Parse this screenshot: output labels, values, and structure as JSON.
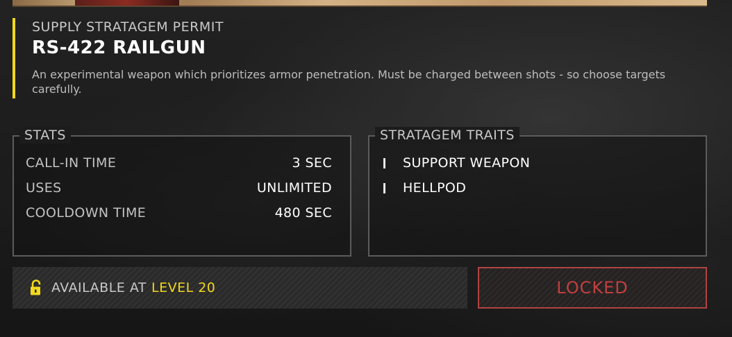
{
  "header": {
    "eyebrow": "SUPPLY STRATAGEM PERMIT",
    "title": "RS-422 RAILGUN",
    "description": "An experimental weapon which prioritizes armor penetration. Must be charged between shots - so choose targets carefully."
  },
  "stats": {
    "legend": "STATS",
    "rows": [
      {
        "label": "CALL-IN TIME",
        "value": "3 SEC"
      },
      {
        "label": "USES",
        "value": "UNLIMITED"
      },
      {
        "label": "COOLDOWN TIME",
        "value": "480 SEC"
      }
    ]
  },
  "traits": {
    "legend": "STRATAGEM TRAITS",
    "items": [
      {
        "label": "SUPPORT WEAPON"
      },
      {
        "label": "HELLPOD"
      }
    ]
  },
  "availability": {
    "icon": "unlocked-padlock-icon",
    "text": "AVAILABLE AT",
    "level": "LEVEL 20"
  },
  "action": {
    "label": "LOCKED"
  },
  "colors": {
    "accent_yellow": "#f2d81e",
    "locked_red": "#c0403e",
    "panel_border": "#5c5c5c"
  }
}
